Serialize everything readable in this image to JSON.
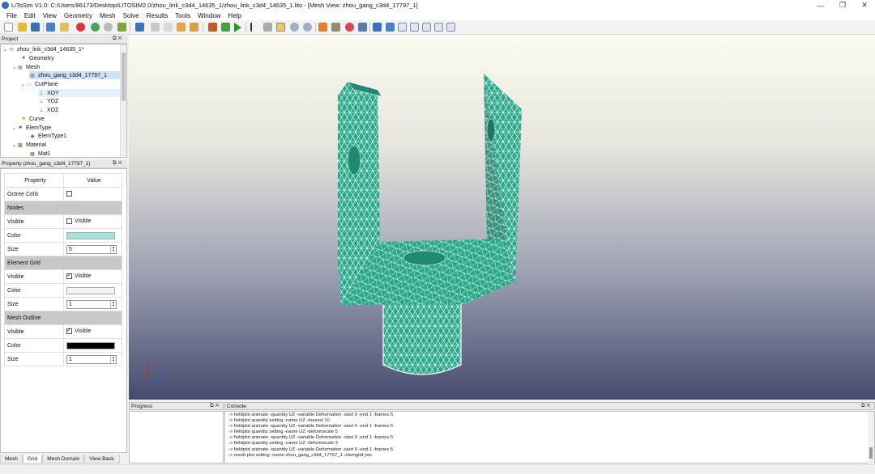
{
  "window": {
    "title": "LiToSim V1.0: C:/Users/86173/Desktop/LITOSIM2.0/zhou_link_c3d4_14635_1/zhou_link_c3d4_14635_1.lito - [Mesh View: zhou_gang_c3d4_17797_1]",
    "minimize_glyph": "—",
    "restore_glyph": "❐",
    "close_glyph": "✕"
  },
  "menu": [
    "File",
    "Edit",
    "View",
    "Geometry",
    "Mesh",
    "Solve",
    "Results",
    "Tools",
    "Window",
    "Help"
  ],
  "project": {
    "title": "Project",
    "controls": "⧉ ✕",
    "items": [
      {
        "label": "zhou_link_c3d4_14635_1*",
        "arrow": "⌄",
        "icon": "⟲",
        "icon_color": "#3c8a3c"
      },
      {
        "label": "Geometry",
        "arrow": "",
        "icon": "■",
        "icon_color": "#9b7b4a"
      },
      {
        "label": "Mesh",
        "arrow": "⌄",
        "icon": "▦",
        "icon_color": "#7a7a9a"
      },
      {
        "label": "zhou_gang_c3d4_17797_1",
        "arrow": "",
        "icon": "▦",
        "icon_color": "#7a7a9a"
      },
      {
        "label": "CutPlane",
        "arrow": "⌄",
        "icon": "▭",
        "icon_color": "#cc7a2a"
      },
      {
        "label": "XOY",
        "arrow": "",
        "icon": "⊥",
        "icon_color": "#3a5fa0"
      },
      {
        "label": "YOZ",
        "arrow": "",
        "icon": "⊥",
        "icon_color": "#3a5fa0"
      },
      {
        "label": "XOZ",
        "arrow": "",
        "icon": "⊥",
        "icon_color": "#3a5fa0"
      },
      {
        "label": "Curve",
        "arrow": "",
        "icon": "■",
        "icon_color": "#e0a820"
      },
      {
        "label": "ElemType",
        "arrow": "⌄",
        "icon": "■",
        "icon_color": "#3a6fb0"
      },
      {
        "label": "ElemType1",
        "arrow": "",
        "icon": "◆",
        "icon_color": "#2e8b57"
      },
      {
        "label": "Material",
        "arrow": "⌄",
        "icon": "▩",
        "icon_color": "#a0522d"
      },
      {
        "label": "Mat1",
        "arrow": "",
        "icon": "▩",
        "icon_color": "#a0522d"
      }
    ]
  },
  "property": {
    "title": "Property (zhou_gang_c3d4_17797_1)",
    "controls": "⧉ ✕",
    "col_property": "Property",
    "col_value": "Value",
    "octree_label": "Octree Cells",
    "nodes_group": "Nodes",
    "nodes_visible_label": "Visible",
    "nodes_visible_text": "Visible",
    "nodes_color_label": "Color",
    "nodes_color": "#a6e3d9",
    "nodes_size_label": "Size",
    "nodes_size": "5",
    "grid_group": "Element Grid",
    "grid_visible_label": "Visible",
    "grid_visible_text": "Visible",
    "grid_color_label": "Color",
    "grid_color": "#f4f4f4",
    "grid_size_label": "Size",
    "grid_size": "1",
    "outline_group": "Mesh Outline",
    "outline_visible_label": "Visible",
    "outline_visible_text": "Visible",
    "outline_color_label": "Color",
    "outline_color": "#000000",
    "outline_size_label": "Size",
    "outline_size": "1"
  },
  "bottom_tabs": [
    "Mesh",
    "Grid",
    "Mesh Domain",
    "View Back."
  ],
  "progress": {
    "title": "Progress",
    "controls": "⧉ ✕"
  },
  "console": {
    "title": "Console",
    "controls": "⧉ ✕",
    "lines": [
      "-> fieldplot animate -quantity UZ -variable Deformation -start 0 -end 1 -frames 5",
      "-> fieldplot quantity setting -name UZ -maxval 10",
      "-> fieldplot animate -quantity UZ -variable Deformation -start 0 -end 1 -frames 5",
      "-> fieldplot quantity setting -name UZ -deformscale 5",
      "-> fieldplot animate -quantity UZ -variable Deformation -start 0 -end 1 -frames 5",
      "-> fieldplot quantity setting -name UZ -deformscale 3",
      "-> fieldplot animate -quantity UZ -variable Deformation -start 0 -end 1 -frames 5",
      "-> mesh plot setting -name zhou_gang_c3d4_17797_1 -elemgrid yes"
    ]
  },
  "colors": {
    "mesh_fill": "#2aa88a",
    "mesh_fill_dark": "#1f8a70",
    "mesh_line": "#ffffff",
    "selection": "#cfe3f5"
  }
}
